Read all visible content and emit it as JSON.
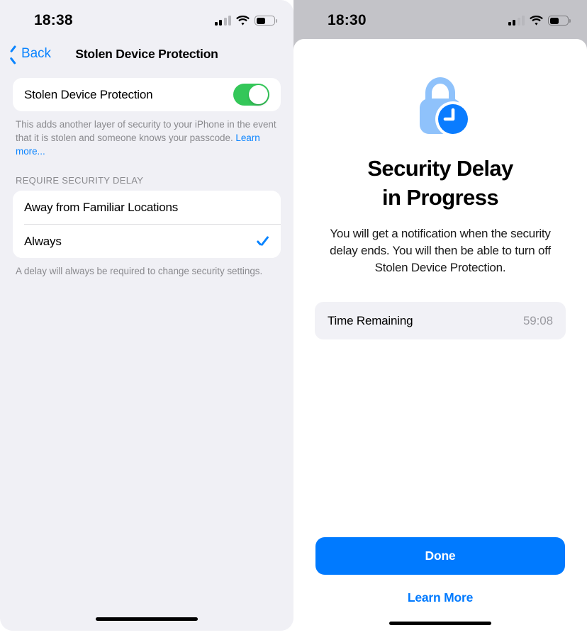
{
  "left": {
    "statusbar": {
      "time": "18:38",
      "signal_icon": "cellular-signal-icon",
      "wifi_icon": "wifi-icon",
      "battery_icon": "battery-icon",
      "battery_level": 52
    },
    "nav": {
      "back_label": "Back",
      "back_icon": "chevron-left-icon",
      "title": "Stolen Device Protection"
    },
    "toggle_row": {
      "label": "Stolen Device Protection",
      "toggle_on": true,
      "toggle_color": "#34C759"
    },
    "footnote": {
      "text": "This adds another layer of security to your iPhone in the event that it is stolen and someone knows your passcode. ",
      "link_label": "Learn more..."
    },
    "group_header": "REQUIRE SECURITY DELAY",
    "options": [
      {
        "label": "Away from Familiar Locations",
        "selected": false
      },
      {
        "label": "Always",
        "selected": true
      }
    ],
    "options_footnote": "A delay will always be required to change security settings.",
    "accent_color": "#0A84FF",
    "background_color": "#F0F0F5"
  },
  "right": {
    "statusbar": {
      "time": "18:30",
      "signal_icon": "cellular-signal-icon",
      "wifi_icon": "wifi-icon",
      "battery_icon": "battery-icon",
      "battery_level": 52
    },
    "hero_icon": "lock-with-clock-icon",
    "hero_icon_colors": {
      "lock": "#8FC2FB",
      "clock": "#0A7CFF"
    },
    "title_line1": "Security Delay",
    "title_line2": "in Progress",
    "body": "You will get a notification when the security delay ends. You will then be able to turn off Stolen Device Protection.",
    "time_row": {
      "label": "Time Remaining",
      "value": "59:08"
    },
    "primary_button": "Done",
    "secondary_link": "Learn More",
    "accent_color": "#007AFF",
    "background_color": "#C3C3C8"
  }
}
